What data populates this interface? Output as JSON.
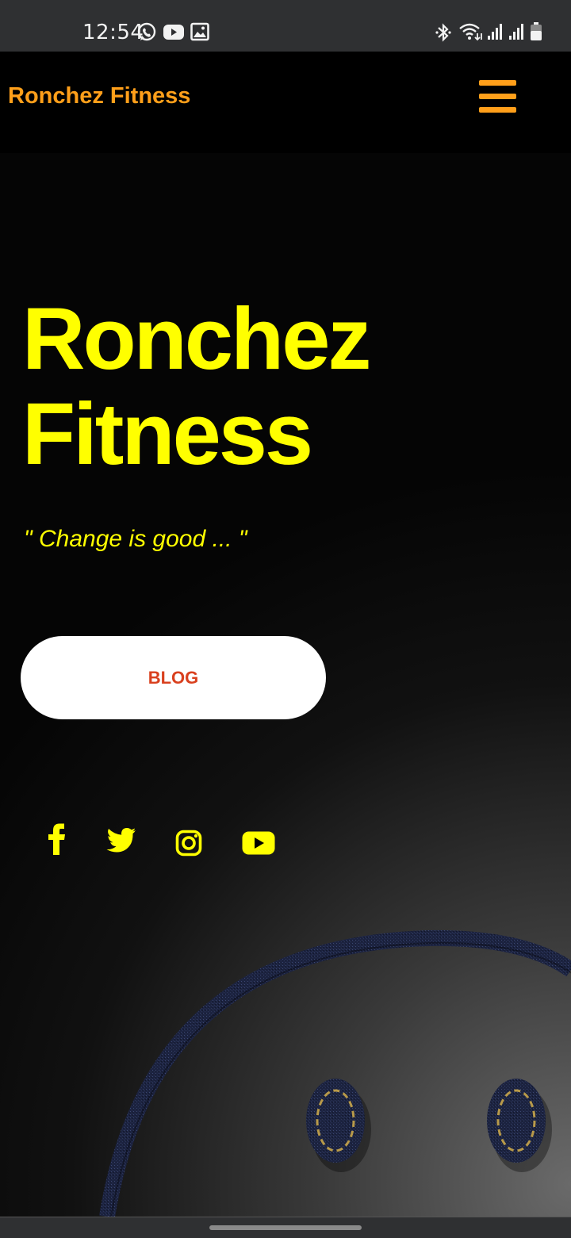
{
  "status_bar": {
    "time": "12:54",
    "left_icons": [
      "whatsapp-icon",
      "youtube-icon",
      "gallery-icon"
    ],
    "right_icons": [
      "bluetooth-icon",
      "wifi-icon",
      "signal-icon",
      "signal-icon",
      "battery-icon"
    ]
  },
  "header": {
    "brand": "Ronchez Fitness",
    "menu_icon": "hamburger-menu-icon"
  },
  "hero": {
    "title_line1": "Ronchez",
    "title_line2": "Fitness",
    "tagline": "\" Change is good ... \"",
    "button_label": "BLOG"
  },
  "social": [
    "facebook-icon",
    "twitter-icon",
    "instagram-icon",
    "youtube-icon"
  ],
  "colors": {
    "brand_orange": "#ff9f1a",
    "hero_yellow": "#ffff00",
    "button_text_red": "#d9401e",
    "status_bar_bg": "#2f3032"
  }
}
